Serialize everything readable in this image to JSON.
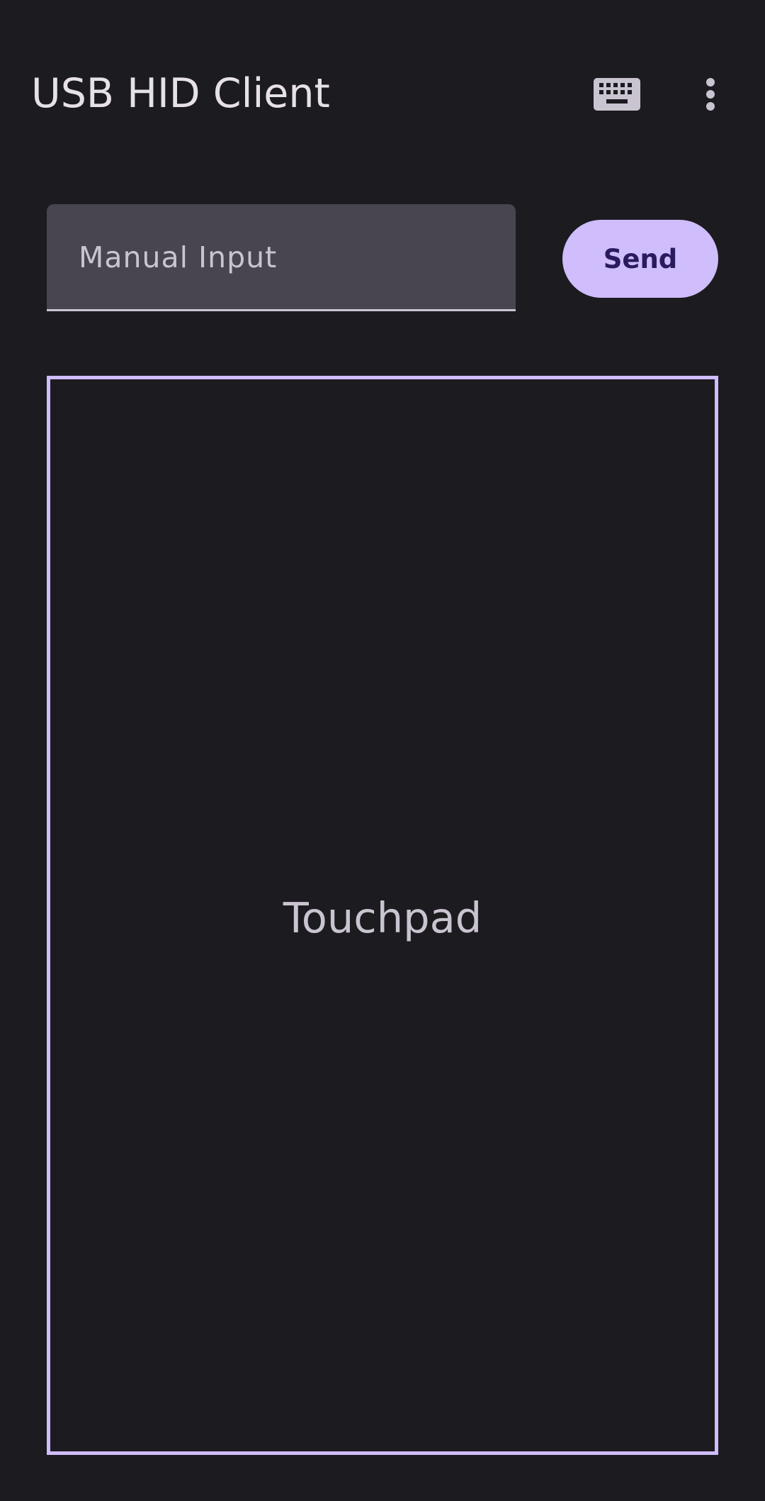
{
  "app_bar": {
    "title": "USB HID Client",
    "icons": [
      "keyboard-icon",
      "more-vert-icon"
    ]
  },
  "manual_input": {
    "placeholder": "Manual Input",
    "value": ""
  },
  "send_button": {
    "label": "Send"
  },
  "touchpad": {
    "label": "Touchpad"
  },
  "colors": {
    "background": "#1c1b20",
    "accent": "#cfbdfc",
    "on_accent": "#2a1a5e",
    "input_fill": "#49454f",
    "text_primary": "#e6e1e6",
    "text_secondary": "#cac4d0"
  }
}
